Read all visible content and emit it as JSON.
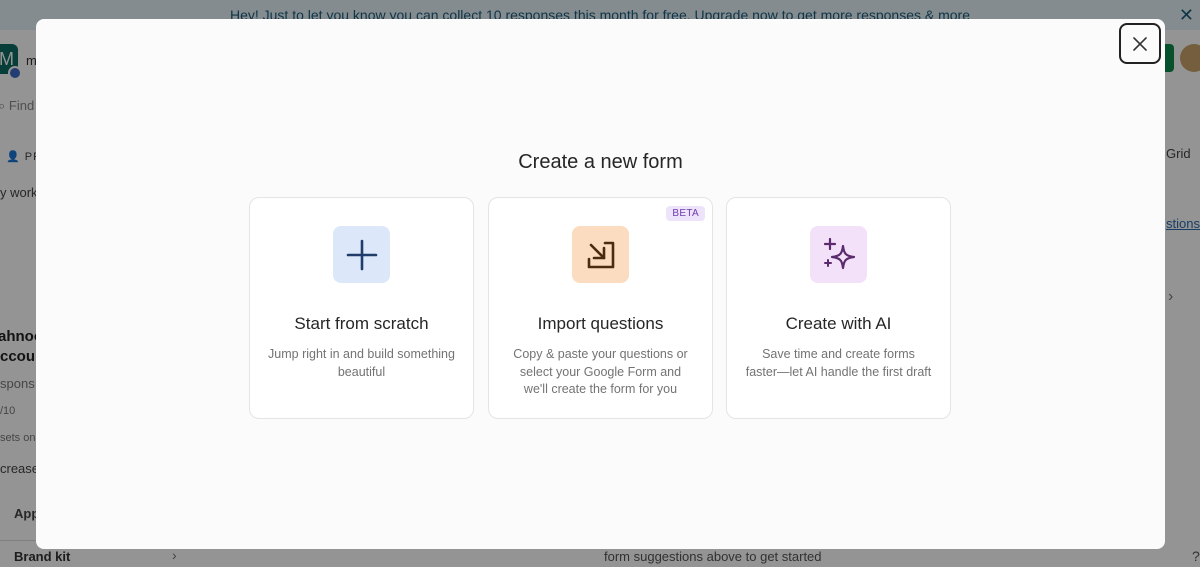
{
  "background": {
    "banner_text": "Hey! Just to let you know you can collect 10 responses this month for free. Upgrade now to get more responses & more",
    "banner_close_glyph": "✕",
    "avatar_letter": "M",
    "workspace_letter": "m",
    "search_fragment": "Find",
    "private_fragment": "PR",
    "workspace_fragment": "y work",
    "form_title_line1": "ahnoo",
    "form_title_line2": "ccoun",
    "responses_fragment": "spons",
    "count_fragment": "/10",
    "resets_fragment": "sets on",
    "increase_fragment": "crease",
    "apps_fragment": "App",
    "brand_kit_label": "Brand kit",
    "grid_label": "Grid",
    "suggestions_fragment": "stions",
    "bottom_hint": "form suggestions above to get started"
  },
  "modal": {
    "title": "Create a new form",
    "close_label": "Close",
    "cards": [
      {
        "title": "Start from scratch",
        "description": "Jump right in and build something beautiful",
        "icon": "plus-icon",
        "icon_bg": "#dce7f9",
        "icon_color": "#1f3c6b"
      },
      {
        "title": "Import questions",
        "description": "Copy & paste your questions or select your Google Form and we'll create the form for you",
        "badge": "BETA",
        "icon": "import-arrow-icon",
        "icon_bg": "#fbdcc0",
        "icon_color": "#4a2c12"
      },
      {
        "title": "Create with AI",
        "description": "Save time and create forms faster—let AI handle the first draft",
        "icon": "sparkles-icon",
        "icon_bg": "#f2e1f8",
        "icon_color": "#5c2a6e"
      }
    ]
  }
}
